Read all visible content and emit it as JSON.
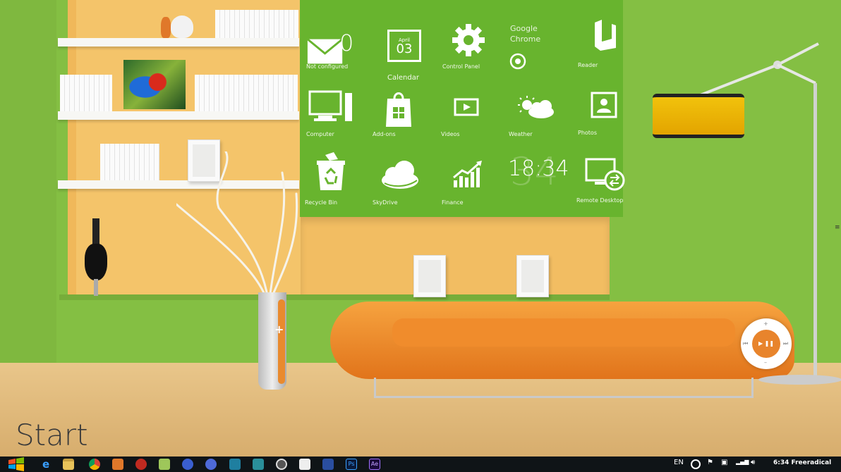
{
  "tiles": {
    "mail": {
      "label": "Not configured",
      "count": "0",
      "icon": "mail-icon"
    },
    "calendar": {
      "label": "Calendar",
      "month": "April",
      "day": "03",
      "icon": "calendar-icon"
    },
    "control_panel": {
      "label": "Control Panel",
      "icon": "gear-icon"
    },
    "chrome": {
      "label": "Google Chrome",
      "icon": "chrome-icon"
    },
    "reader": {
      "label": "Reader",
      "icon": "reader-icon"
    },
    "computer": {
      "label": "Computer",
      "icon": "computer-icon"
    },
    "addons": {
      "label": "Add-ons",
      "icon": "store-bag-icon"
    },
    "videos": {
      "label": "Videos",
      "icon": "video-play-icon"
    },
    "weather": {
      "label": "Weather",
      "icon": "weather-icon"
    },
    "photos": {
      "label": "Photos",
      "icon": "photos-icon"
    },
    "recycle_bin": {
      "label": "Recycle Bin",
      "icon": "recycle-bin-icon"
    },
    "skydrive": {
      "label": "SkyDrive",
      "icon": "cloud-icon"
    },
    "finance": {
      "label": "Finance",
      "icon": "chart-icon"
    },
    "clock": {
      "time": "18:34",
      "shadow": "34"
    },
    "remote_desktop": {
      "label": "Remote Desktop",
      "icon": "remote-desktop-icon"
    }
  },
  "start_label": "Start",
  "taskbar": {
    "apps": [
      "internet-explorer",
      "file-explorer",
      "chrome",
      "app-4",
      "app-5",
      "app-6",
      "app-7",
      "app-8",
      "app-9",
      "app-10",
      "app-11",
      "app-12",
      "app-13",
      "photoshop",
      "after-effects"
    ],
    "photoshop_label": "Ps",
    "after_effects_label": "Ae",
    "language": "EN",
    "clock": "6:34 Freeradical"
  },
  "colors": {
    "tiles_bg": "#68b42e",
    "wall": "#84bf43",
    "sofa": "#f08c2c",
    "taskbar": "#0f1417"
  }
}
